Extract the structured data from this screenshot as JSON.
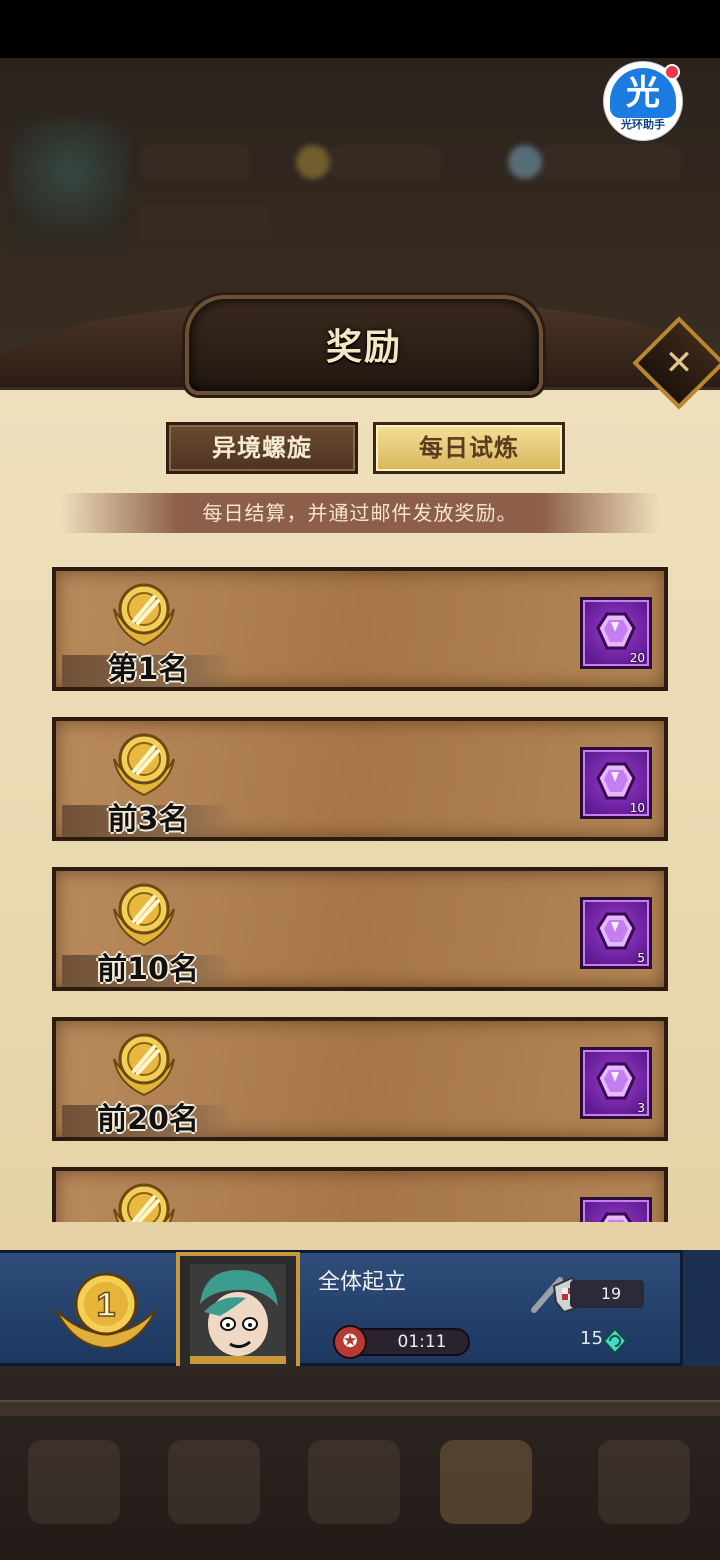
{
  "overlay_badge": {
    "glyph": "光",
    "label": "光环助手"
  },
  "dialog": {
    "title": "奖励",
    "close_glyph": "✕",
    "tabs": [
      {
        "label": "异境螺旋",
        "active": false
      },
      {
        "label": "每日试炼",
        "active": true
      }
    ],
    "subtitle": "每日结算，并通过邮件发放奖励。",
    "rewards": [
      {
        "rank": "第1名",
        "item": "purple-gem",
        "quantity": "20"
      },
      {
        "rank": "前3名",
        "item": "purple-gem",
        "quantity": "10"
      },
      {
        "rank": "前10名",
        "item": "purple-gem",
        "quantity": "5"
      },
      {
        "rank": "前20名",
        "item": "purple-gem",
        "quantity": "3"
      },
      {
        "rank": "",
        "item": "purple-gem",
        "quantity": ""
      }
    ]
  },
  "my_rank": {
    "rank": "1",
    "player_name": "全体起立",
    "timer": "01:11",
    "power": "19",
    "score": "15"
  },
  "colors": {
    "panel": "#efe0bd",
    "row": "#a67648",
    "gem_box": "#7a2bb0",
    "footer": "#2e4e7a",
    "active_tab": "#e8c874"
  }
}
